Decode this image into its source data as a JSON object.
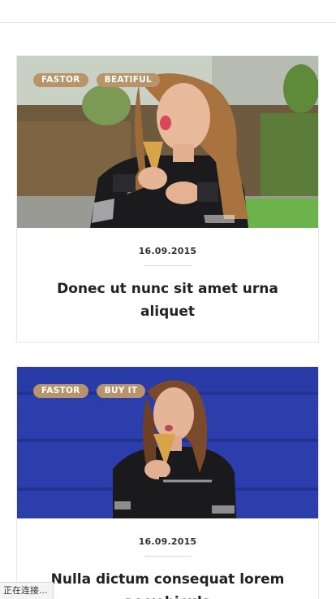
{
  "posts": [
    {
      "tags": [
        "FASTOR",
        "BEATIFUL"
      ],
      "date": "16.09.2015",
      "title": "Donec ut nunc sit amet urna aliquet"
    },
    {
      "tags": [
        "FASTOR",
        "BUY IT"
      ],
      "date": "16.09.2015",
      "title": "Nulla dictum consequat lorem ac vehicula"
    }
  ],
  "status_bar": {
    "text": "正在连接..."
  },
  "colors": {
    "tag_background": "#b8946b",
    "card_border": "#e9e9e9",
    "photo2_background": "#2a3aa8"
  }
}
